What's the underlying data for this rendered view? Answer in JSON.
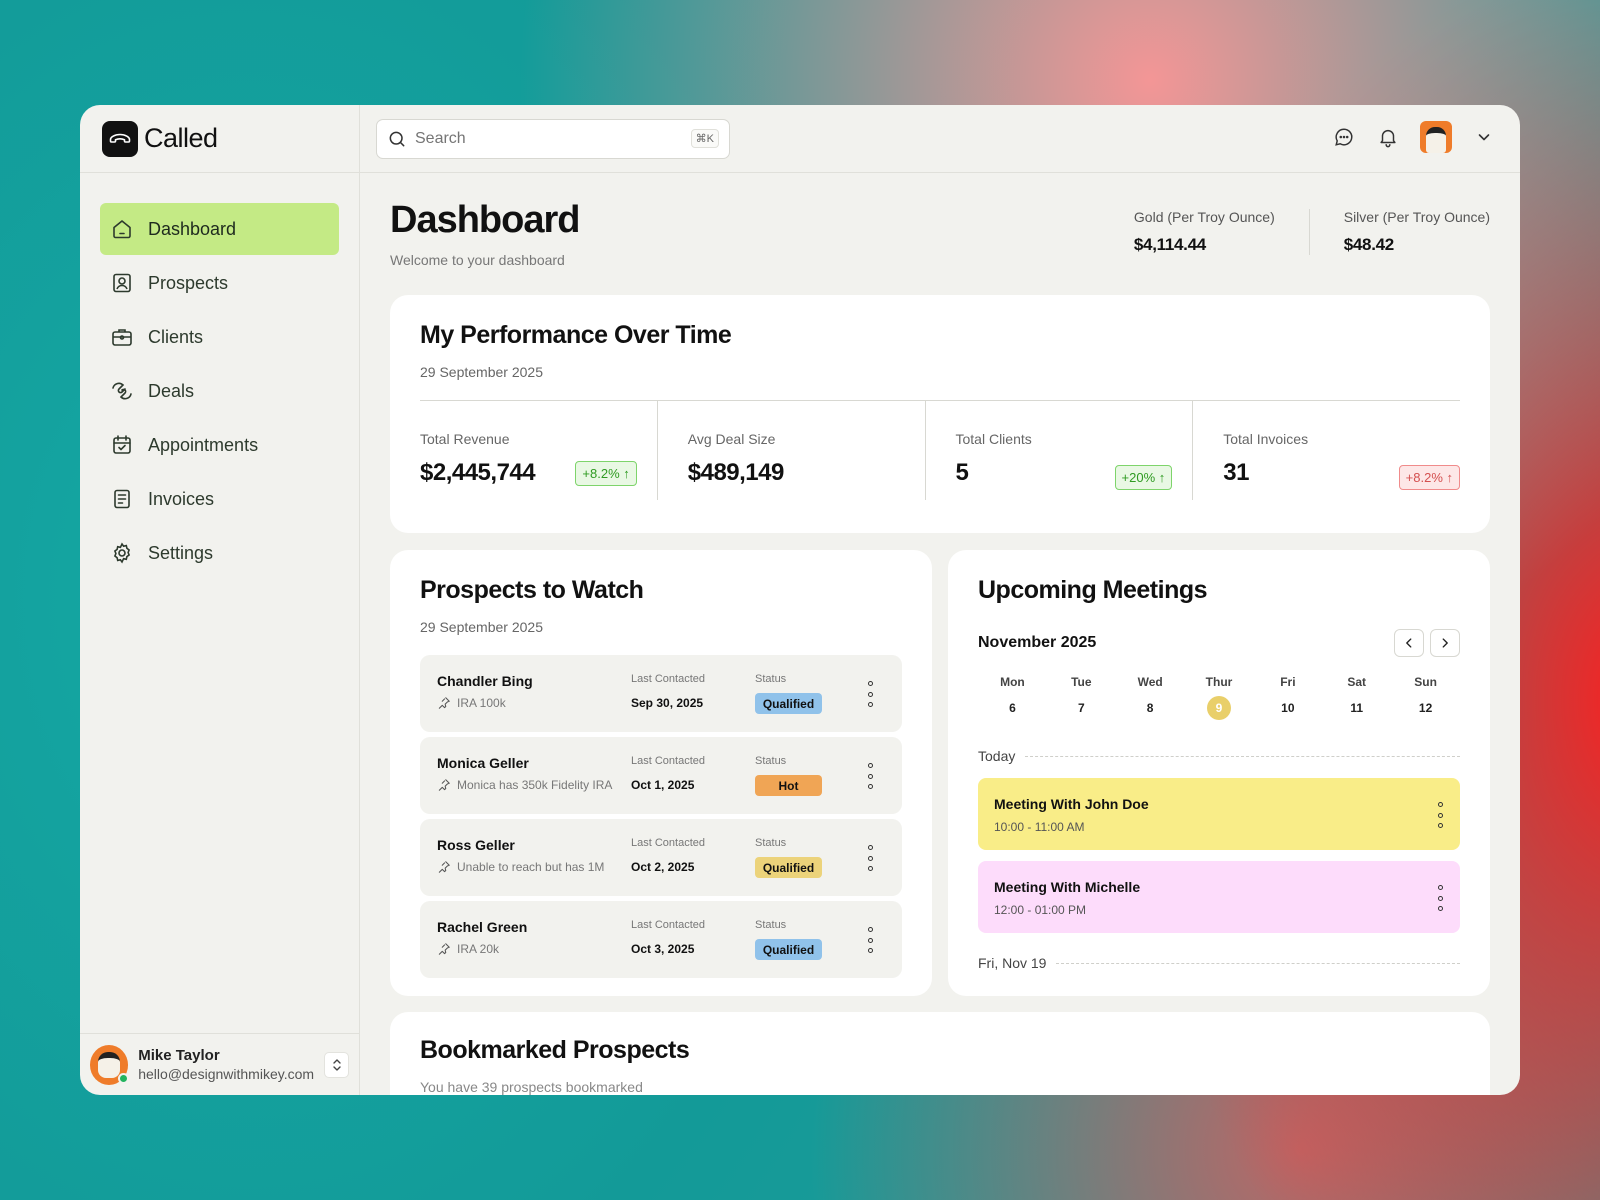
{
  "brand": {
    "name": "Called"
  },
  "sidebar": {
    "items": [
      {
        "label": "Dashboard",
        "icon": "home-icon",
        "active": true
      },
      {
        "label": "Prospects",
        "icon": "user-card-icon",
        "active": false
      },
      {
        "label": "Clients",
        "icon": "briefcase-icon",
        "active": false
      },
      {
        "label": "Deals",
        "icon": "handshake-icon",
        "active": false
      },
      {
        "label": "Appointments",
        "icon": "calendar-check-icon",
        "active": false
      },
      {
        "label": "Invoices",
        "icon": "receipt-icon",
        "active": false
      },
      {
        "label": "Settings",
        "icon": "gear-icon",
        "active": false
      }
    ],
    "user": {
      "name": "Mike Taylor",
      "email": "hello@designwithmikey.com"
    }
  },
  "search": {
    "placeholder": "Search",
    "shortcut": "⌘K"
  },
  "header": {
    "title": "Dashboard",
    "subtitle": "Welcome to your dashboard",
    "metals": [
      {
        "label": "Gold (Per Troy Ounce)",
        "value": "$4,114.44"
      },
      {
        "label": "Silver (Per Troy Ounce)",
        "value": "$48.42"
      }
    ]
  },
  "performance": {
    "title": "My Performance Over Time",
    "date": "29 September 2025",
    "stats": [
      {
        "label": "Total Revenue",
        "value": "$2,445,744",
        "badge": "+8.2% ↑",
        "trend": "up"
      },
      {
        "label": "Avg Deal Size",
        "value": "$489,149",
        "badge": "",
        "trend": ""
      },
      {
        "label": "Total Clients",
        "value": "5",
        "badge": "+20% ↑",
        "trend": "up"
      },
      {
        "label": "Total Invoices",
        "value": "31",
        "badge": "+8.2% ↑",
        "trend": "down"
      }
    ]
  },
  "prospects": {
    "title": "Prospects to Watch",
    "date": "29 September 2025",
    "last_contacted_label": "Last Contacted",
    "status_label": "Status",
    "rows": [
      {
        "name": "Chandler Bing",
        "note": "IRA 100k",
        "last_contacted": "Sep 30, 2025",
        "status": "Qualified",
        "status_color": "#90c2ea"
      },
      {
        "name": "Monica Geller",
        "note": "Monica has 350k Fidelity IRA",
        "last_contacted": "Oct 1, 2025",
        "status": "Hot",
        "status_color": "#f0a555"
      },
      {
        "name": "Ross Geller",
        "note": "Unable to reach but has 1M",
        "last_contacted": "Oct 2, 2025",
        "status": "Qualified",
        "status_color": "#ecd37a"
      },
      {
        "name": "Rachel Green",
        "note": "IRA 20k",
        "last_contacted": "Oct 3, 2025",
        "status": "Qualified",
        "status_color": "#90c2ea"
      }
    ]
  },
  "meetings": {
    "title": "Upcoming Meetings",
    "month": "November 2025",
    "days": [
      {
        "name": "Mon",
        "num": "6",
        "today": false
      },
      {
        "name": "Tue",
        "num": "7",
        "today": false
      },
      {
        "name": "Wed",
        "num": "8",
        "today": false
      },
      {
        "name": "Thur",
        "num": "9",
        "today": true
      },
      {
        "name": "Fri",
        "num": "10",
        "today": false
      },
      {
        "name": "Sat",
        "num": "11",
        "today": false
      },
      {
        "name": "Sun",
        "num": "12",
        "today": false
      }
    ],
    "today_label": "Today",
    "next_label": "Fri, Nov 19",
    "items": [
      {
        "title": "Meeting With John Doe",
        "time": "10:00 - 11:00 AM",
        "color": "#f9ed88"
      },
      {
        "title": "Meeting With Michelle",
        "time": "12:00 - 01:00 PM",
        "color": "#fddcfb"
      }
    ]
  },
  "bookmarked": {
    "title": "Bookmarked Prospects",
    "subtitle": "You have 39 prospects bookmarked"
  },
  "colors": {
    "accent": "#c4ea85",
    "badge_up": "#2f9b22",
    "badge_down": "#d45050"
  }
}
